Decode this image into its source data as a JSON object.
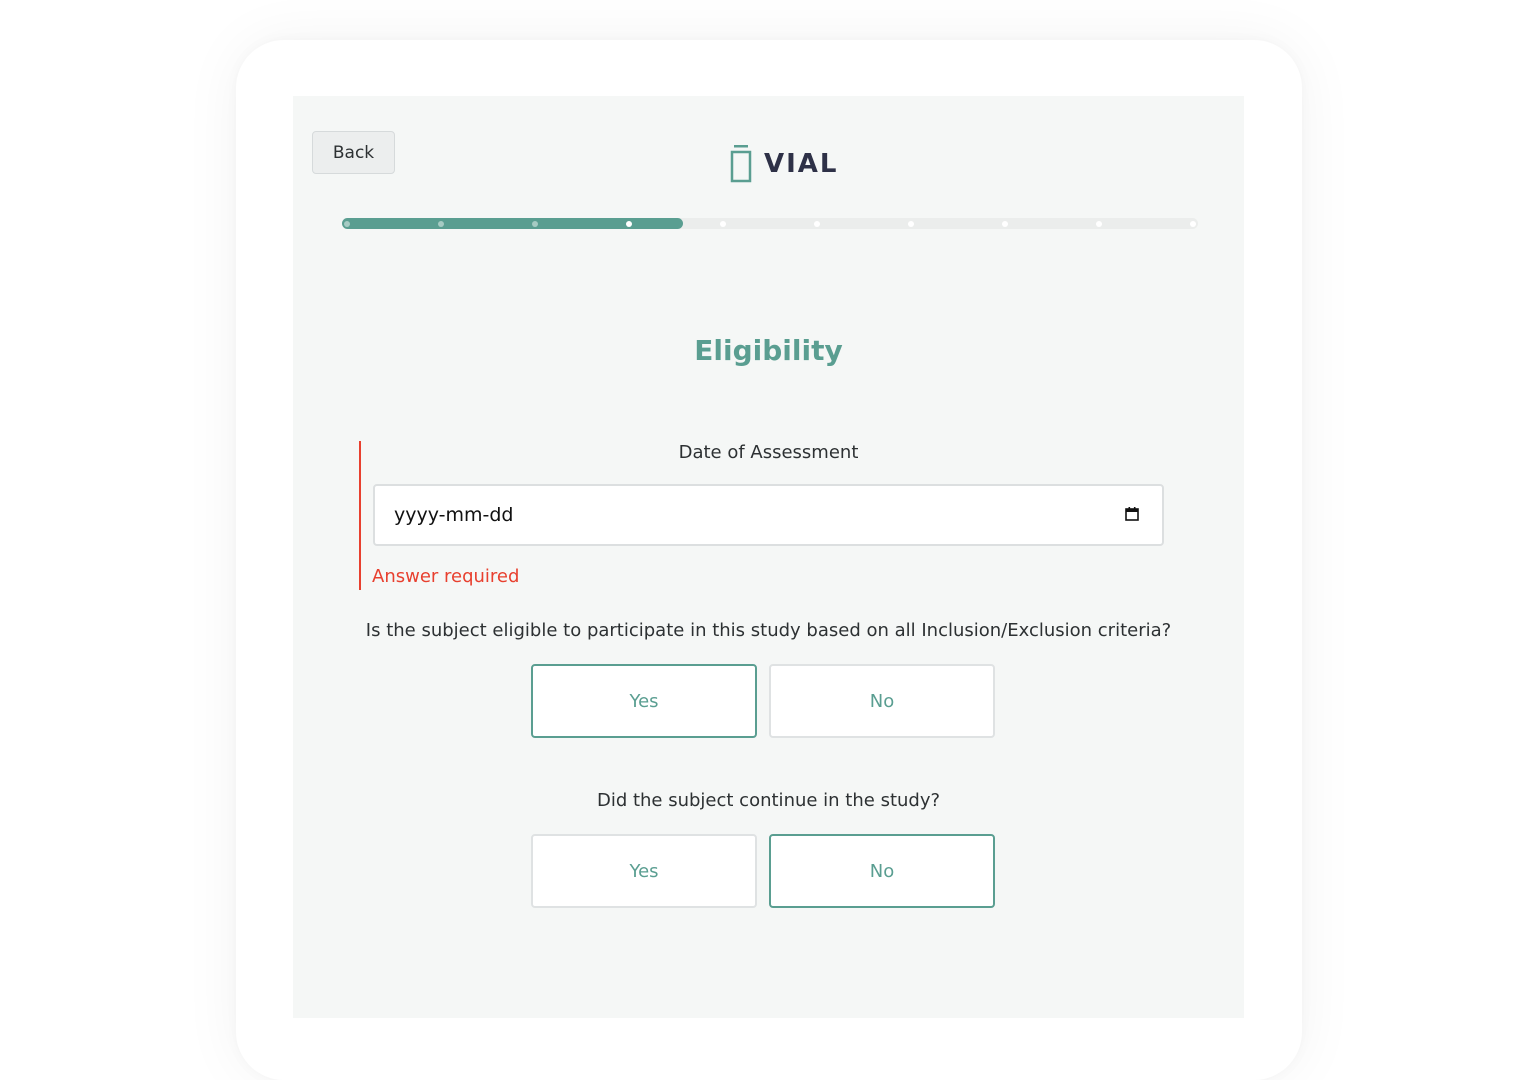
{
  "header": {
    "back_label": "Back",
    "logo_text": "VIAL"
  },
  "progress": {
    "total_steps": 10,
    "current_step": 4
  },
  "section": {
    "title": "Eligibility"
  },
  "date_field": {
    "label": "Date of Assessment",
    "value": "yyyy-mm-dd",
    "error": "Answer required"
  },
  "questions": [
    {
      "text": "Is the subject eligible to participate in this study based on all Inclusion/Exclusion criteria?",
      "options": [
        "Yes",
        "No"
      ],
      "selected": "Yes"
    },
    {
      "text": "Did the subject continue in the study?",
      "options": [
        "Yes",
        "No"
      ],
      "selected": "No"
    }
  ],
  "colors": {
    "accent": "#5a9e91",
    "error": "#e8402f",
    "logo_text": "#2e3147",
    "screen_bg": "#f5f7f6"
  }
}
